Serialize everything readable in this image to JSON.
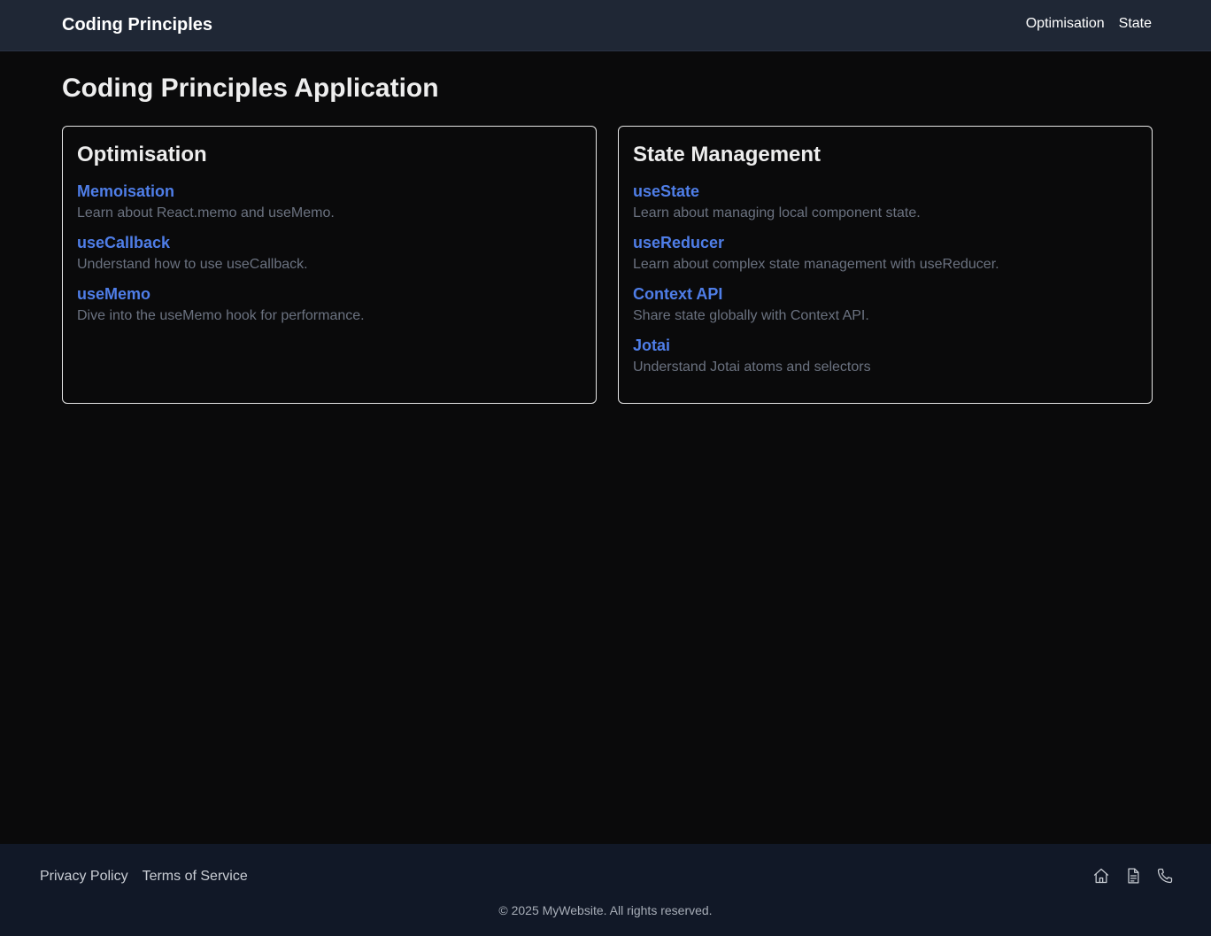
{
  "header": {
    "brand": "Coding Principles",
    "nav": [
      {
        "label": "Optimisation"
      },
      {
        "label": "State"
      }
    ]
  },
  "main": {
    "title": "Coding Principles Application",
    "cards": [
      {
        "title": "Optimisation",
        "topics": [
          {
            "label": "Memoisation",
            "description": "Learn about React.memo and useMemo."
          },
          {
            "label": "useCallback",
            "description": "Understand how to use useCallback."
          },
          {
            "label": "useMemo",
            "description": "Dive into the useMemo hook for performance."
          }
        ]
      },
      {
        "title": "State Management",
        "topics": [
          {
            "label": "useState",
            "description": "Learn about managing local component state."
          },
          {
            "label": "useReducer",
            "description": "Learn about complex state management with useReducer."
          },
          {
            "label": "Context API",
            "description": "Share state globally with Context API."
          },
          {
            "label": "Jotai",
            "description": "Understand Jotai atoms and selectors"
          }
        ]
      }
    ]
  },
  "footer": {
    "links": [
      {
        "label": "Privacy Policy"
      },
      {
        "label": "Terms of Service"
      }
    ],
    "icons": [
      "home-icon",
      "document-icon",
      "phone-icon"
    ],
    "copyright": "© 2025 MyWebsite. All rights reserved."
  },
  "colors": {
    "background": "#0a0a0b",
    "header": "#1f2735",
    "footer": "#111827",
    "link": "#4f7ee8",
    "muted": "#6b7280"
  }
}
